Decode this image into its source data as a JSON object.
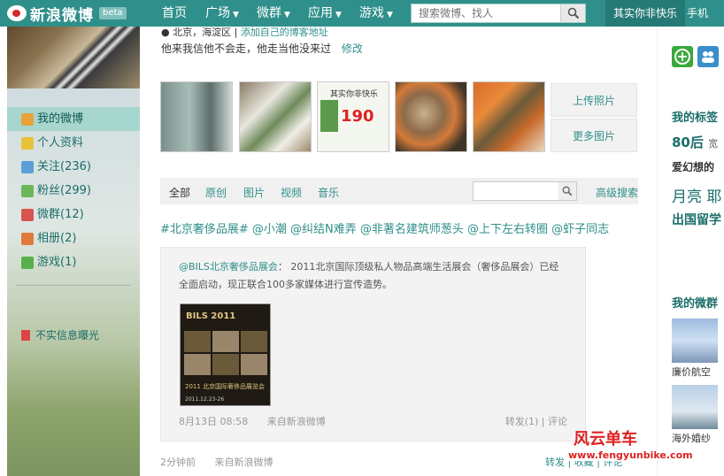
{
  "topnav": {
    "logo": "新浪微博",
    "beta": "beta",
    "items": [
      {
        "label": "首页",
        "caret": false
      },
      {
        "label": "广场",
        "caret": true
      },
      {
        "label": "微群",
        "caret": true
      },
      {
        "label": "应用",
        "caret": true
      },
      {
        "label": "游戏",
        "caret": true
      }
    ],
    "search_placeholder": "搜索微博、找人",
    "user": "其实你非快乐",
    "phone": "手机"
  },
  "sidebar": {
    "items": [
      {
        "label": "我的微博",
        "icon": "home-icon",
        "color": "#e9a23b"
      },
      {
        "label": "个人资料",
        "icon": "profile-icon",
        "color": "#e9c23b"
      },
      {
        "label": "关注(236)",
        "icon": "follow-icon",
        "color": "#5aa0d6"
      },
      {
        "label": "粉丝(299)",
        "icon": "fans-icon",
        "color": "#6bb85a"
      },
      {
        "label": "微群(12)",
        "icon": "group-icon",
        "color": "#d9534f"
      },
      {
        "label": "相册(2)",
        "icon": "album-icon",
        "color": "#e07a3b"
      },
      {
        "label": "游戏(1)",
        "icon": "game-icon",
        "color": "#58b04a"
      }
    ],
    "report": "不实信息曝光"
  },
  "profile": {
    "location": "北京，海淀区",
    "add_blog": "添加自己的博客地址",
    "bio": "他来我信他不会走，他走当他没来过",
    "edit": "修改"
  },
  "photos": {
    "upload": "上传照片",
    "more": "更多图片",
    "thumb_text_1": "其实你非快乐",
    "thumb_text_2": "190"
  },
  "feed_tabs": [
    "全部",
    "原创",
    "图片",
    "视频",
    "音乐"
  ],
  "feed": {
    "advanced_search": "高级搜索",
    "post_text": "#北京奢侈品展# @小潮 @纠结N难弄 @非著名建筑师葱头 @上下左右转圈 @虾子同志",
    "repost_author": "@BILS北京奢侈品展会",
    "repost_text": "：  2011北京国际顶级私人物品高端生活展会（奢侈品展会）已经全面启动，现正联合100多家媒体进行宣传造势。",
    "poster_title": "BILS 2011",
    "poster_subtitle": "2011 北京国际奢侈品展览会",
    "poster_date": "2011.12.23-26",
    "repost_time": "8月13日 08:58",
    "repost_source": "来自新浪微博",
    "repost_forward": "转发(1)",
    "repost_comment": "评论",
    "post_time": "2分钟前",
    "post_source": "来自新浪微博",
    "post_forward": "转发",
    "post_collect": "收藏",
    "post_comment": "评论"
  },
  "right": {
    "tags_title": "我的标签",
    "tag1": "80后",
    "tag1b": "宽",
    "tag2": "爱幻想的",
    "tag3": "月亮",
    "tag3b": "耶",
    "tag4": "出国留学",
    "groups_title": "我的微群",
    "group1": "廉价航空",
    "group2": "海外婚纱"
  },
  "watermark": {
    "title": "风云单车",
    "url": "www.fengyunbike.com"
  }
}
